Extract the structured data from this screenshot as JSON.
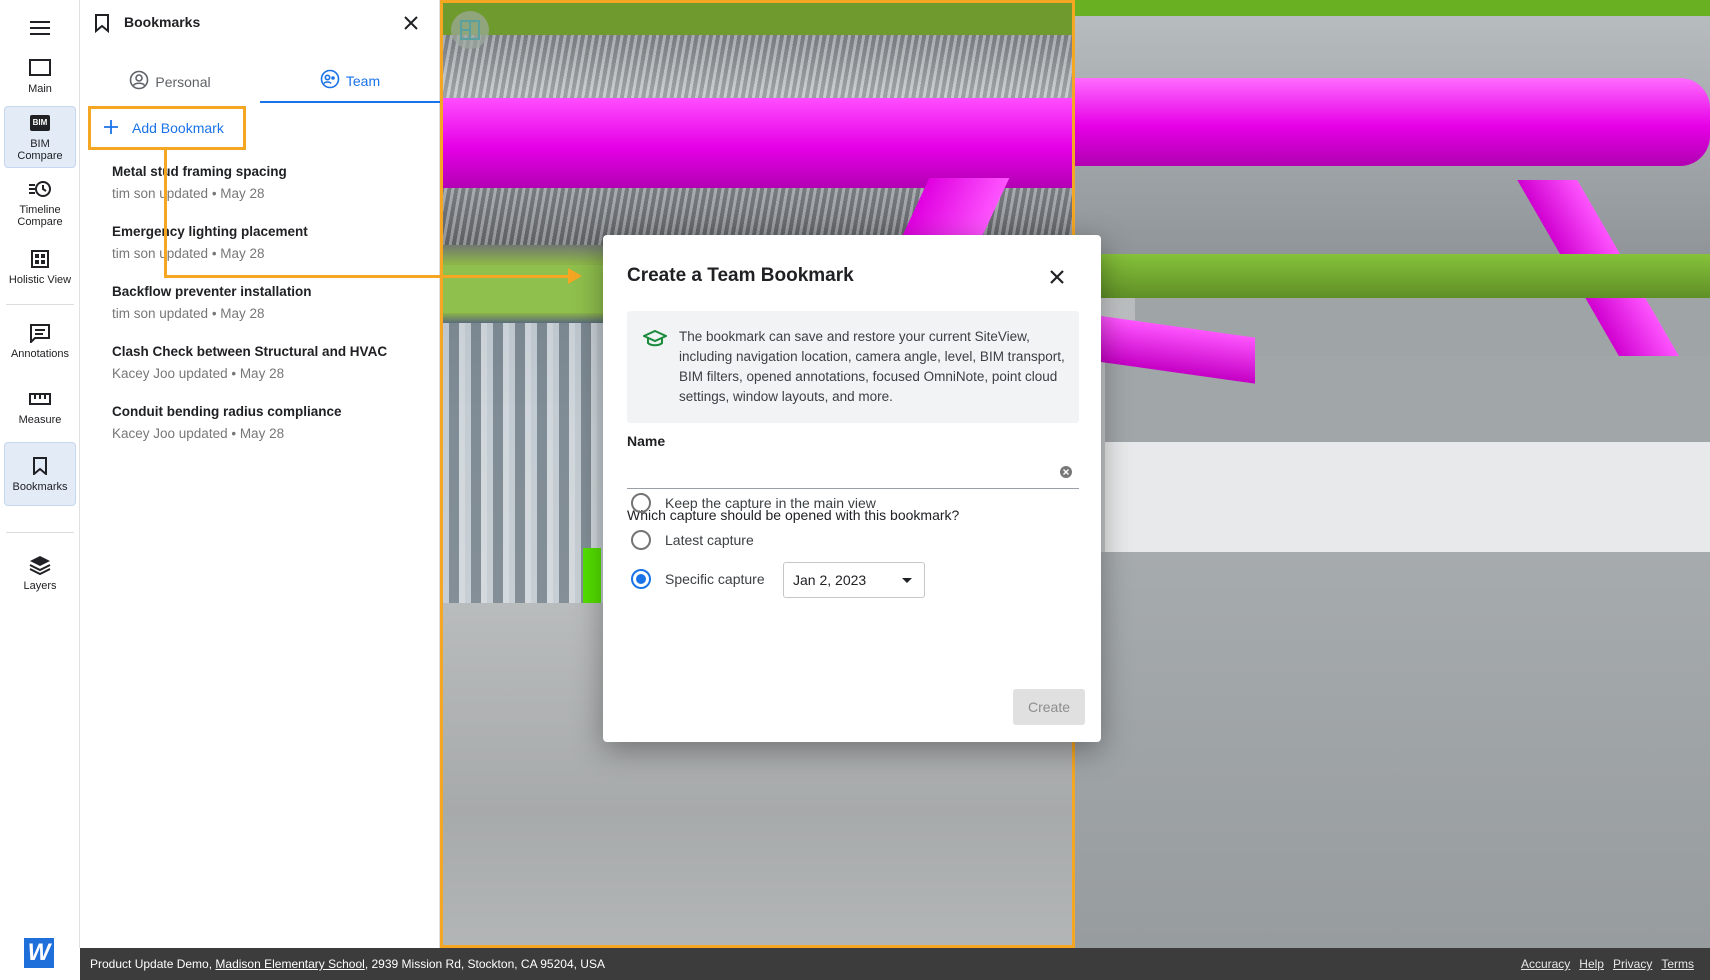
{
  "rail": {
    "items": [
      {
        "label": "Main"
      },
      {
        "label": "BIM\nCompare",
        "badge": "BIM"
      },
      {
        "label": "Timeline\nCompare"
      },
      {
        "label": "Holistic View"
      },
      {
        "label": "Annotations"
      },
      {
        "label": "Measure"
      },
      {
        "label": "Bookmarks"
      },
      {
        "label": "Layers"
      }
    ],
    "logo": "W"
  },
  "panel": {
    "title": "Bookmarks",
    "tabs": [
      {
        "label": "Personal"
      },
      {
        "label": "Team"
      }
    ],
    "add_label": "Add Bookmark",
    "bookmarks": [
      {
        "name": "Metal stud framing spacing",
        "meta": "tim son updated • May 28"
      },
      {
        "name": "Emergency lighting placement",
        "meta": "tim son updated • May 28"
      },
      {
        "name": "Backflow preventer installation",
        "meta": "tim son updated • May 28"
      },
      {
        "name": "Clash Check between Structural and HVAC",
        "meta": "Kacey Joo updated • May 28"
      },
      {
        "name": "Conduit bending radius compliance",
        "meta": "Kacey Joo updated • May 28"
      }
    ]
  },
  "dialog": {
    "title": "Create a Team Bookmark",
    "info": "The bookmark can save and restore your current SiteView, including navigation location, camera angle, level, BIM transport, BIM filters, opened annotations, focused OmniNote, point cloud settings, window layouts, and more.",
    "name_label": "Name",
    "name_value": "",
    "question": "Which capture should be opened with this bookmark?",
    "options": [
      {
        "label": "Keep the capture in the main view",
        "checked": false
      },
      {
        "label": "Latest capture",
        "checked": false
      },
      {
        "label": "Specific capture",
        "checked": true
      }
    ],
    "date_value": "Jan 2, 2023",
    "create_label": "Create"
  },
  "footer": {
    "project": "Product Update Demo, ",
    "school": "Madison Elementary School",
    "address": ", 2939 Mission Rd, Stockton, CA 95204, USA",
    "links": [
      "Accuracy",
      "Help",
      "Privacy",
      "Terms"
    ]
  },
  "colors": {
    "accent": "#1a73e8",
    "highlight": "#f5a623",
    "duct": "#e600e6"
  }
}
